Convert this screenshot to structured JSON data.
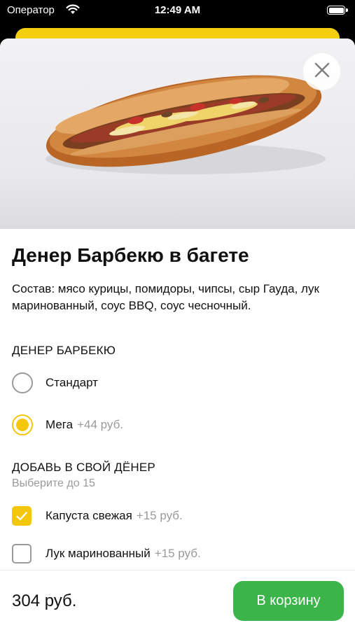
{
  "status_bar": {
    "carrier": "Оператор",
    "time": "12:49 AM"
  },
  "product": {
    "title": "Денер Барбекю в багете",
    "description": "Состав: мясо курицы, помидоры, чипсы, сыр Гауда, лук маринованный, соус BBQ, соус чесночный."
  },
  "size_section": {
    "title": "ДЕНЕР БАРБЕКЮ",
    "options": [
      {
        "label": "Стандарт",
        "extra": "",
        "selected": false
      },
      {
        "label": "Мега",
        "extra": "+44 руб.",
        "selected": true
      }
    ]
  },
  "addons_section": {
    "title": "ДОБАВЬ В СВОЙ ДЁНЕР",
    "subtitle": "Выберите до 15",
    "options": [
      {
        "label": "Капуста свежая",
        "extra": "+15 руб.",
        "checked": true
      },
      {
        "label": "Лук маринованный",
        "extra": "+15 руб.",
        "checked": false
      }
    ]
  },
  "footer": {
    "price": "304 руб.",
    "cart_label": "В корзину"
  },
  "colors": {
    "accent_yellow": "#f4c70c",
    "cart_green": "#3bb54a"
  },
  "icons": {
    "close": "close-icon",
    "wifi": "wifi-icon",
    "battery": "battery-icon",
    "check": "checkmark-icon"
  }
}
